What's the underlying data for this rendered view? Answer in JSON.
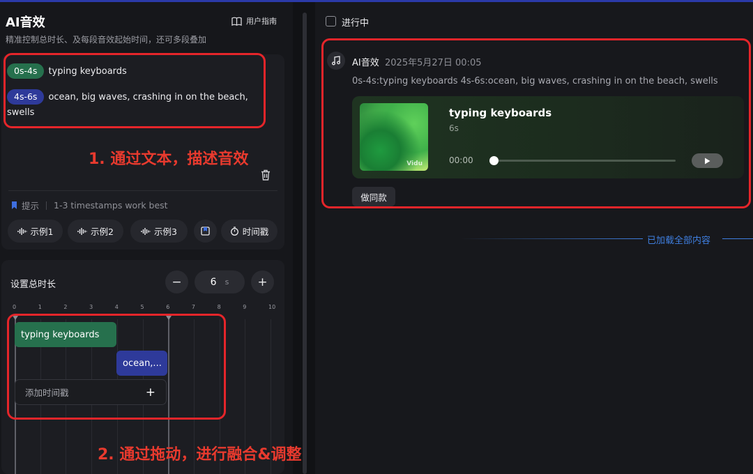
{
  "left_panel": {
    "title": "AI音效",
    "guide_label": "用户指南",
    "subtitle": "精准控制总时长、及每段音效起始时间，还可多段叠加",
    "prompt_lines": [
      {
        "time": "0s-4s",
        "text": "typing keyboards",
        "color": "#26704d"
      },
      {
        "time": "4s-6s",
        "text": "ocean, big waves, crashing in on the beach, swells",
        "color": "#2e3a9a"
      }
    ],
    "tip_label": "提示",
    "tip_text": "1-3 timestamps work best",
    "examples": [
      "示例1",
      "示例2",
      "示例3"
    ],
    "timestamp_label": "时间戳",
    "duration_label": "设置总时长",
    "duration_value": "6",
    "duration_unit": "s",
    "minus": "−",
    "plus": "+",
    "ruler": [
      "0",
      "1",
      "2",
      "3",
      "4",
      "5",
      "6",
      "7",
      "8",
      "9",
      "10"
    ],
    "segments": [
      {
        "label": "typing keyboards"
      },
      {
        "label": "ocean,..."
      }
    ],
    "add_timestamp": "添加时间戳",
    "add_plus": "+"
  },
  "right_panel": {
    "in_progress_label": "进行中",
    "generation": {
      "title": "AI音效",
      "time": "2025年5月27日 00:05",
      "prompt": "0s-4s:typing keyboards  4s-6s:ocean, big waves, crashing in on the beach, swells",
      "track_title": "typing keyboards",
      "track_duration": "6s",
      "current_time": "00:00",
      "progress": 0,
      "watermark": "Vidu",
      "same_button": "做同款"
    },
    "loaded_text": "已加载全部内容"
  },
  "annotations": {
    "step1": "1. 通过文本，描述音效",
    "step2": "2. 通过拖动，进行融合&调整"
  },
  "colors": {
    "accent_red": "#e5252a",
    "loaded_blue": "#3f7fe0",
    "segment_green": "#26704d",
    "segment_blue": "#2e3a9a"
  }
}
